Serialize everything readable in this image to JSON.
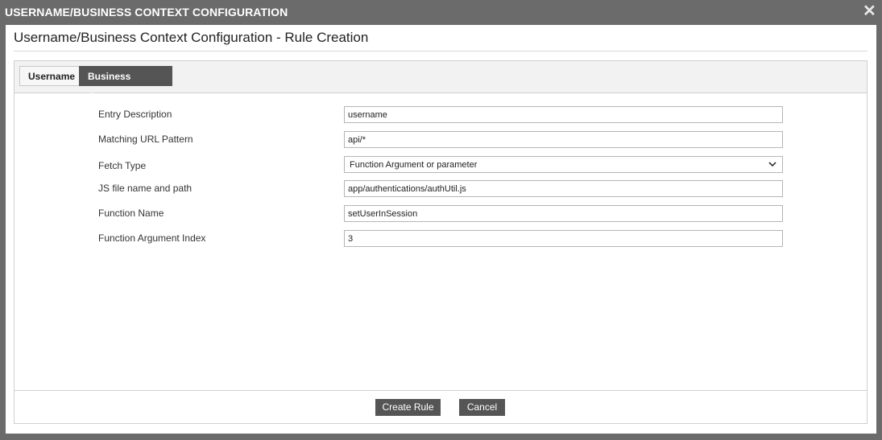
{
  "window": {
    "title": "USERNAME/BUSINESS CONTEXT CONFIGURATION",
    "close_glyph": "✕",
    "close_icon": "close-icon"
  },
  "dialog": {
    "heading": "Username/Business Context Configuration - Rule Creation"
  },
  "tabs": [
    {
      "label": "Username",
      "active": false
    },
    {
      "label": "Business Context",
      "active": true
    }
  ],
  "form": {
    "entry_description": {
      "label": "Entry Description",
      "value": "username"
    },
    "url_pattern": {
      "label": "Matching URL Pattern",
      "value": "api/*"
    },
    "fetch_type": {
      "label": "Fetch Type",
      "value": "Function Argument or parameter",
      "icon": "chevron-down-icon"
    },
    "js_file": {
      "label": "JS file name and path",
      "value": "app/authentications/authUtil.js"
    },
    "function_name": {
      "label": "Function Name",
      "value": "setUserInSession"
    },
    "argument_index": {
      "label": "Function Argument Index",
      "value": "3"
    }
  },
  "buttons": {
    "create": "Create Rule",
    "cancel": "Cancel"
  },
  "colors": {
    "chrome": "#6b6b6b",
    "button": "#555555",
    "active_tab": "#555555"
  }
}
